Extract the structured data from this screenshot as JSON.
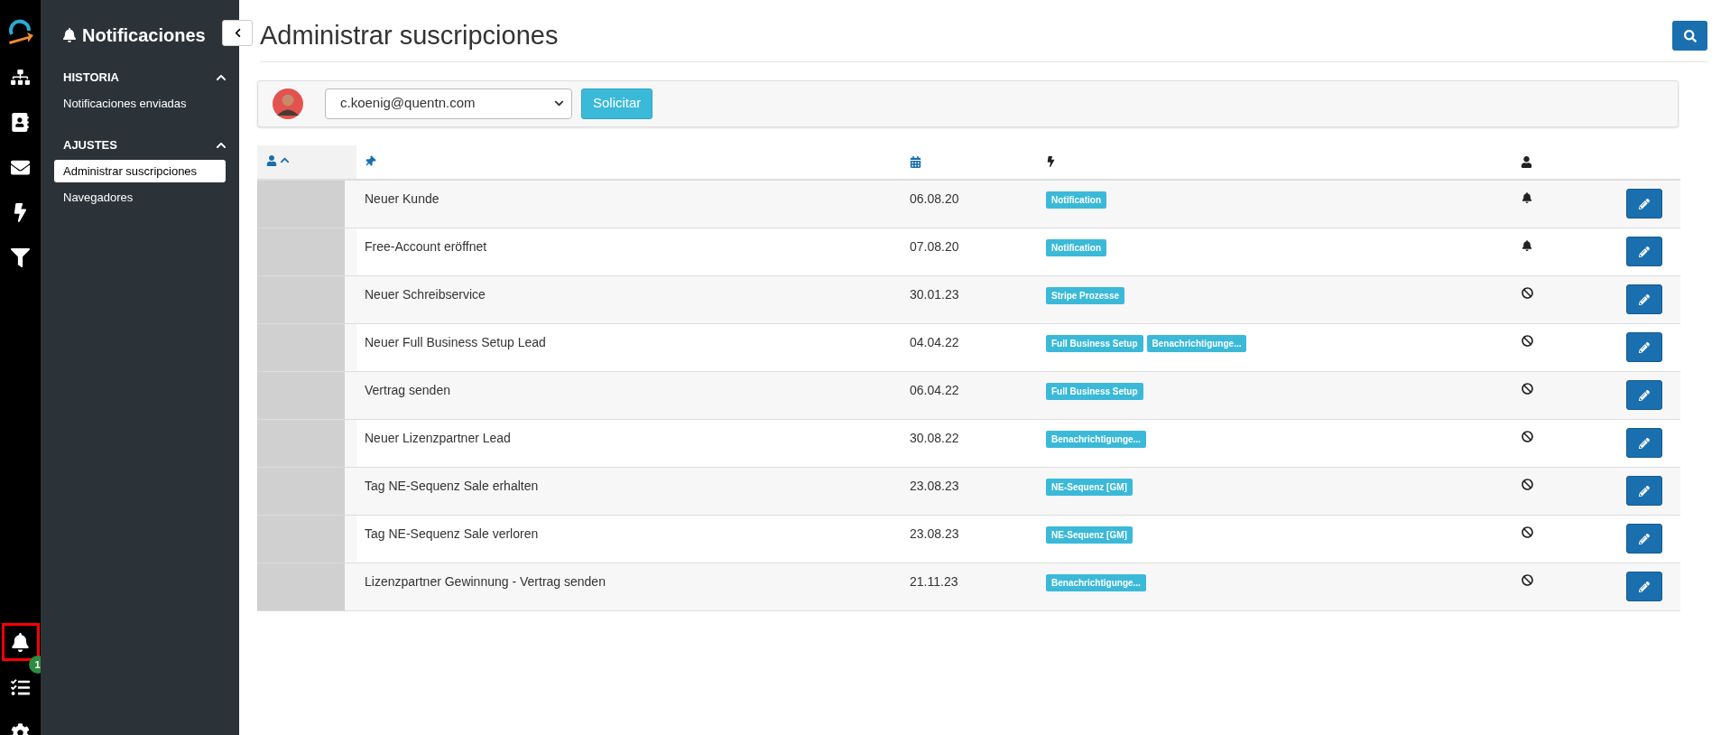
{
  "rail": {
    "top": [
      {
        "kind": "logo",
        "selected": false
      },
      {
        "kind": "flow",
        "selected": false
      },
      {
        "kind": "contacts",
        "selected": false
      },
      {
        "kind": "mail",
        "selected": false
      },
      {
        "kind": "bolt",
        "selected": false
      },
      {
        "kind": "funnel",
        "selected": false
      }
    ],
    "bottom": [
      {
        "kind": "bell",
        "selected": true
      },
      {
        "kind": "tasks",
        "selected": false,
        "badge": "1"
      },
      {
        "kind": "gear",
        "selected": false
      }
    ]
  },
  "sidebar": {
    "title": "Notificaciones",
    "sections": [
      {
        "label": "HISTORIA",
        "expanded": true,
        "items": [
          {
            "label": "Notificaciones enviadas",
            "selected": false
          }
        ]
      },
      {
        "label": "AJUSTES",
        "expanded": true,
        "items": [
          {
            "label": "Administrar suscripciones",
            "selected": true
          },
          {
            "label": "Navegadores",
            "selected": false
          }
        ]
      }
    ]
  },
  "page": {
    "title": "Administrar suscripciones"
  },
  "toolbar": {
    "user_select": "c.koenig@quentn.com",
    "button": "Solicitar"
  },
  "table": {
    "rows": [
      {
        "name": "Neuer Kunde",
        "date": "06.08.20",
        "tags": [
          "Notification"
        ],
        "subscribed": true
      },
      {
        "name": "Free-Account eröffnet",
        "date": "07.08.20",
        "tags": [
          "Notification"
        ],
        "subscribed": true
      },
      {
        "name": "Neuer Schreibservice",
        "date": "30.01.23",
        "tags": [
          "Stripe Prozesse"
        ],
        "subscribed": false
      },
      {
        "name": "Neuer Full Business Setup Lead",
        "date": "04.04.22",
        "tags": [
          "Full Business Setup",
          "Benachrichtigunge..."
        ],
        "subscribed": false
      },
      {
        "name": "Vertrag senden",
        "date": "06.04.22",
        "tags": [
          "Full Business Setup"
        ],
        "subscribed": false
      },
      {
        "name": "Neuer Lizenzpartner Lead",
        "date": "30.08.22",
        "tags": [
          "Benachrichtigunge..."
        ],
        "subscribed": false
      },
      {
        "name": "Tag NE-Sequenz Sale erhalten",
        "date": "23.08.23",
        "tags": [
          "NE-Sequenz [GM]"
        ],
        "subscribed": false
      },
      {
        "name": "Tag NE-Sequenz Sale verloren",
        "date": "23.08.23",
        "tags": [
          "NE-Sequenz [GM]"
        ],
        "subscribed": false
      },
      {
        "name": "Lizenzpartner Gewinnung - Vertrag senden",
        "date": "21.11.23",
        "tags": [
          "Benachrichtigunge..."
        ],
        "subscribed": false
      }
    ]
  }
}
